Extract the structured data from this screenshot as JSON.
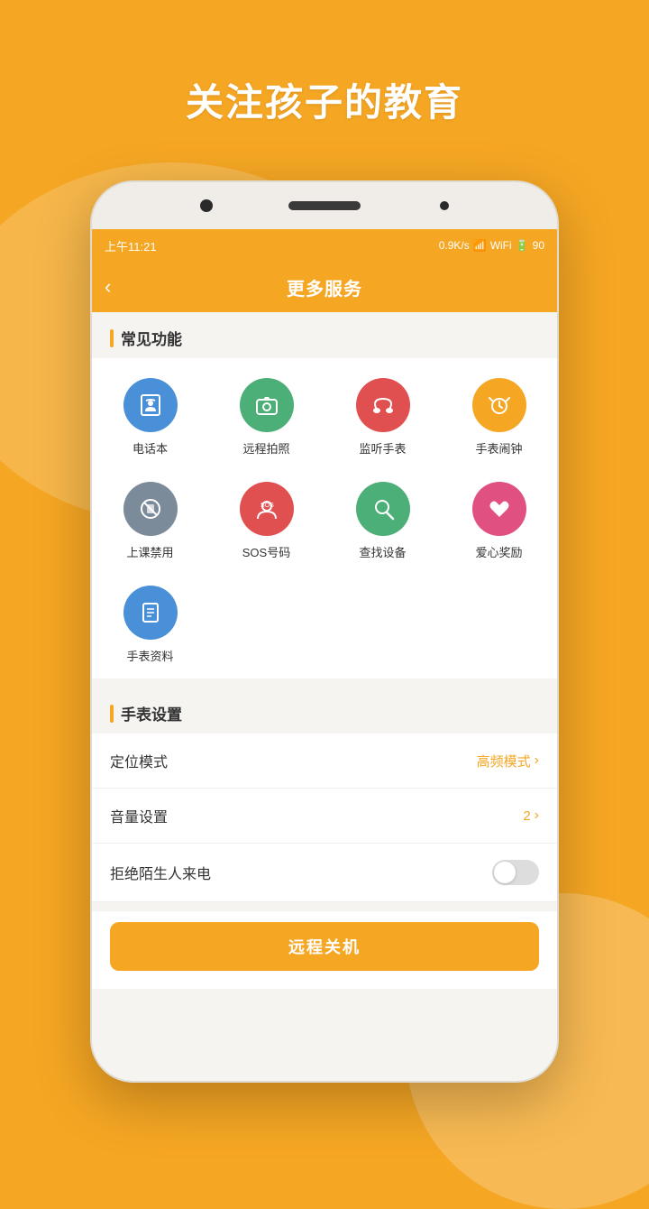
{
  "app": {
    "headline": "关注孩子的教育",
    "status_bar": {
      "time": "上午11:21",
      "network_speed": "0.9K/s",
      "battery": "90"
    },
    "header": {
      "title": "更多服务",
      "back_label": "‹"
    },
    "common_section": {
      "label": "常见功能",
      "icons": [
        {
          "id": "phonebook",
          "label": "电话本",
          "emoji": "📞",
          "color_class": "icon-blue"
        },
        {
          "id": "remote-photo",
          "label": "远程拍照",
          "emoji": "📷",
          "color_class": "icon-green"
        },
        {
          "id": "watch-monitor",
          "label": "监听手表",
          "emoji": "🎧",
          "color_class": "icon-red"
        },
        {
          "id": "watch-alarm",
          "label": "手表闹钟",
          "emoji": "⏰",
          "color_class": "icon-orange"
        },
        {
          "id": "class-ban",
          "label": "上课禁用",
          "emoji": "🚫",
          "color_class": "icon-gray"
        },
        {
          "id": "sos",
          "label": "SOS号码",
          "emoji": "🆘",
          "color_class": "icon-red2"
        },
        {
          "id": "find-device",
          "label": "查找设备",
          "emoji": "🔍",
          "color_class": "icon-green2"
        },
        {
          "id": "love-reward",
          "label": "爱心奖励",
          "emoji": "❤️",
          "color_class": "icon-pink"
        },
        {
          "id": "watch-info",
          "label": "手表资料",
          "emoji": "📋",
          "color_class": "icon-blue2"
        }
      ]
    },
    "watch_section": {
      "label": "手表设置",
      "settings": [
        {
          "id": "location-mode",
          "label": "定位模式",
          "value": "高频模式",
          "type": "link"
        },
        {
          "id": "volume-setting",
          "label": "音量设置",
          "value": "2",
          "type": "link"
        },
        {
          "id": "reject-stranger",
          "label": "拒绝陌生人来电",
          "value": "",
          "type": "toggle"
        }
      ]
    },
    "bottom_button": {
      "label": "远程关机"
    }
  }
}
